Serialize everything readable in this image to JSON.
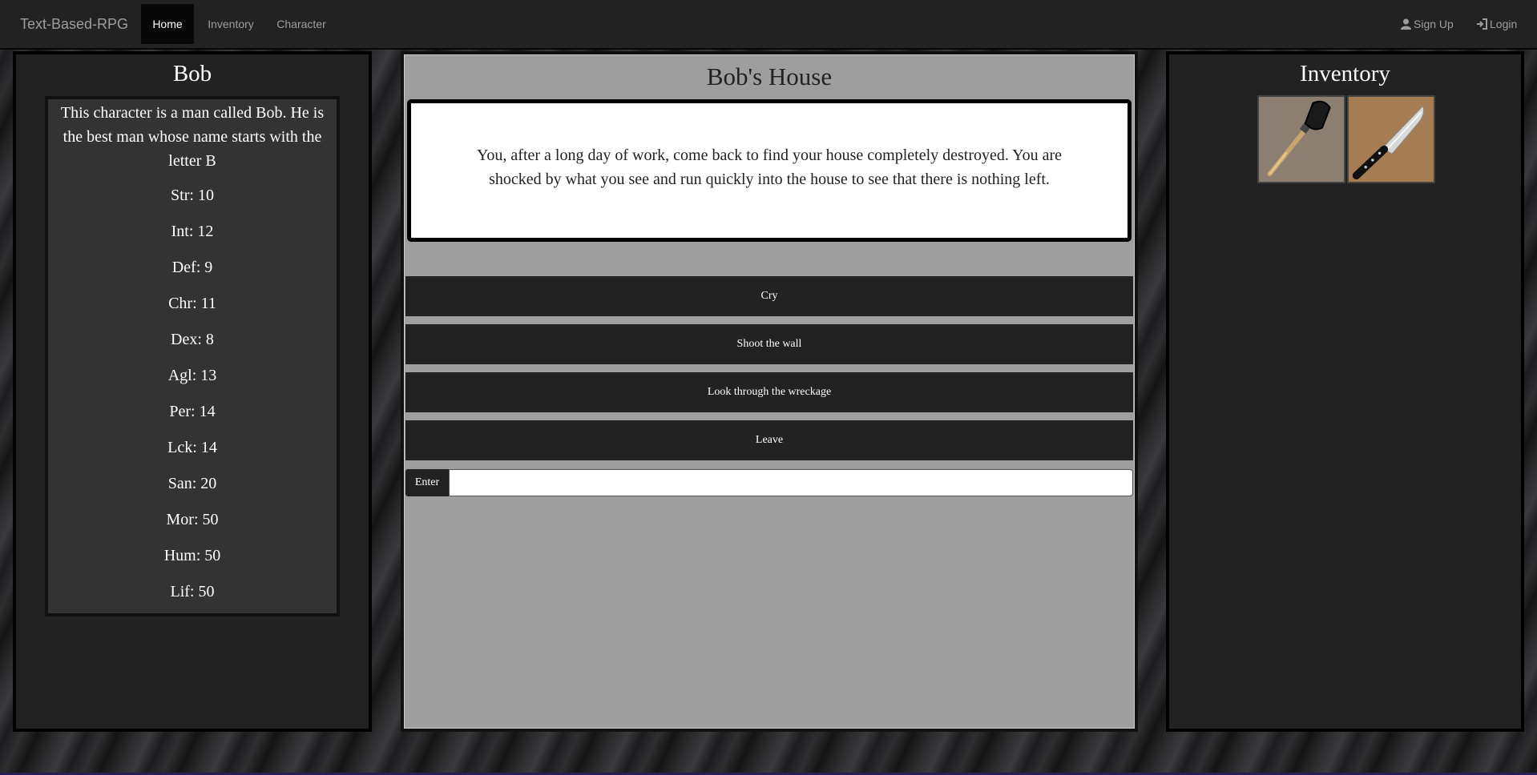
{
  "navbar": {
    "brand": "Text-Based-RPG",
    "links": [
      {
        "label": "Home"
      },
      {
        "label": "Inventory"
      },
      {
        "label": "Character"
      }
    ],
    "right": [
      {
        "label": "Sign Up",
        "icon": "user-icon"
      },
      {
        "label": "Login",
        "icon": "login-icon"
      }
    ]
  },
  "character": {
    "name": "Bob",
    "description": "This character is a man called Bob. He is the best man whose name starts with the letter B",
    "stats": [
      "Str: 10",
      "Int: 12",
      "Def: 9",
      "Chr: 11",
      "Dex: 8",
      "Agl: 13",
      "Per: 14",
      "Lck: 14",
      "San: 20",
      "Mor: 50",
      "Hum: 50",
      "Lif: 50"
    ]
  },
  "scene": {
    "title": "Bob's House",
    "story": "You, after a long day of work, come back to find your house completely destroyed. You are shocked by what you see and run quickly into the house to see that there is nothing left.",
    "choices": [
      "Cry",
      "Shoot the wall",
      "Look through the wreckage",
      "Leave"
    ],
    "enter_label": "Enter",
    "input_value": ""
  },
  "inventory": {
    "title": "Inventory",
    "items": [
      {
        "name": "shovel",
        "icon": "shovel-icon"
      },
      {
        "name": "knife",
        "icon": "knife-icon"
      }
    ]
  }
}
